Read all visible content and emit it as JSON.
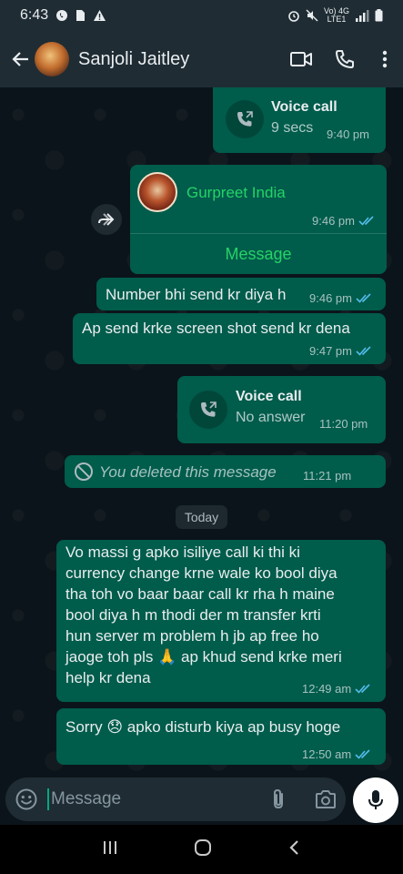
{
  "status_bar": {
    "time": "6:43",
    "network": "Vo) 4G\nLTE1"
  },
  "header": {
    "contact_name": "Sanjoli Jaitley"
  },
  "messages": {
    "call1": {
      "title": "Voice call",
      "subtitle": "9 secs",
      "time": "9:40 pm"
    },
    "contact_card": {
      "name": "Gurpreet India",
      "time": "9:46 pm",
      "action": "Message"
    },
    "msg1": {
      "text": "Number bhi send kr diya h",
      "time": "9:46 pm"
    },
    "msg2": {
      "text": "Ap send krke screen shot send kr dena",
      "time": "9:47 pm"
    },
    "call2": {
      "title": "Voice call",
      "subtitle": "No answer",
      "time": "11:20 pm"
    },
    "deleted": {
      "text": "You deleted this message",
      "time": "11:21 pm"
    },
    "date_divider": "Today",
    "msg3": {
      "line1": "Vo massi g apko isiliye call ki thi ki",
      "line2": "currency change krne wale ko bool diya",
      "line3": "tha toh vo baar baar call kr rha h maine",
      "line4": "bool diya h m thodi der m transfer krti",
      "line5": "hun  server m problem h jb ap free ho",
      "line6": "jaoge toh pls 🙏 ap khud send krke meri",
      "line7": "help kr dena",
      "time": "12:49 am"
    },
    "msg4": {
      "text": "Sorry 😞 apko disturb kiya ap busy hoge",
      "time": "12:50 am"
    }
  },
  "input": {
    "placeholder": "Message"
  },
  "colors": {
    "outgoing_bubble": "#005c4b",
    "header": "#1f2c34",
    "background": "#0b141a",
    "accent": "#00a884",
    "read_tick": "#53bdeb"
  }
}
